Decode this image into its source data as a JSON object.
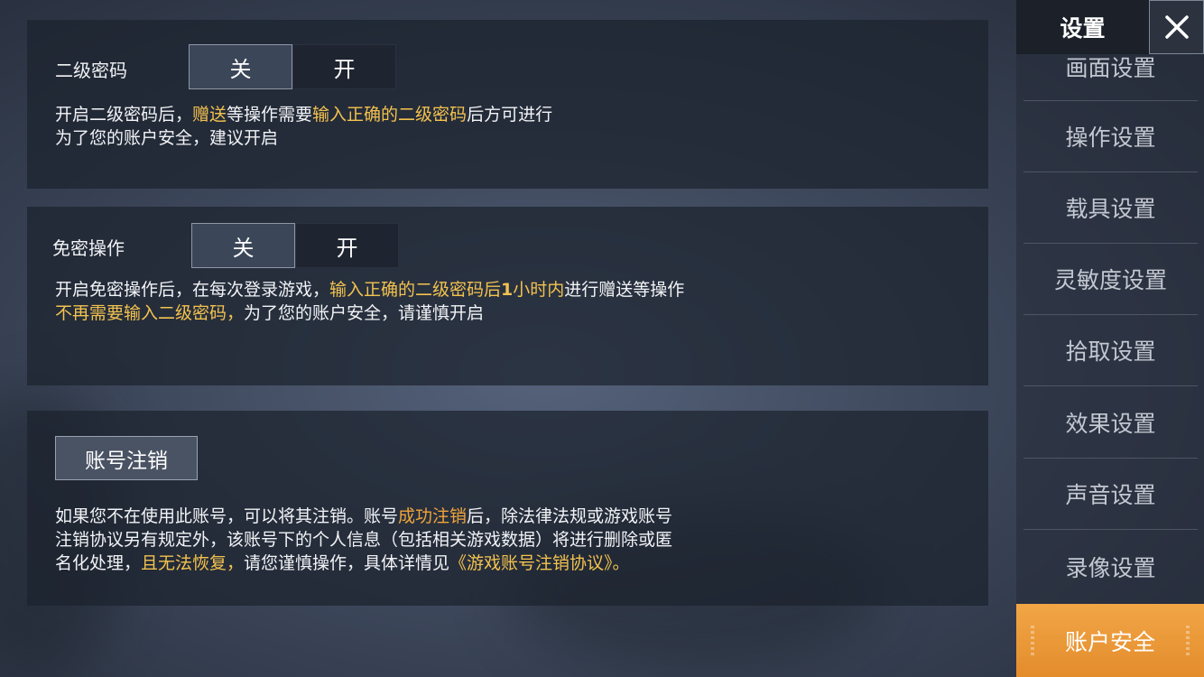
{
  "header": {
    "title": "设置"
  },
  "sidebar": {
    "items": [
      {
        "label": "画面设置"
      },
      {
        "label": "操作设置"
      },
      {
        "label": "载具设置"
      },
      {
        "label": "灵敏度设置"
      },
      {
        "label": "拾取设置"
      },
      {
        "label": "效果设置"
      },
      {
        "label": "声音设置"
      },
      {
        "label": "录像设置"
      },
      {
        "label": "账户安全",
        "active": true
      }
    ]
  },
  "secondary_password": {
    "label": "二级密码",
    "off": "关",
    "on": "开",
    "selected": "关",
    "desc": {
      "line1_a": "开启二级密码后，",
      "line1_b": "赠送",
      "line1_c": "等操作需要",
      "line1_d": "输入正确的二级密码",
      "line1_e": "后方可进行",
      "line2": "为了您的账户安全，建议开启"
    }
  },
  "password_free": {
    "label": "免密操作",
    "off": "关",
    "on": "开",
    "selected": "关",
    "desc": {
      "line1_a": "开启免密操作后，在每次登录游戏，",
      "line1_b": "输入正确的二级密码后",
      "line1_c": "1",
      "line1_d": "小时内",
      "line1_e": "进行赠送等操作",
      "line2_a": "不再需要输入二级密码，",
      "line2_b": "为了您的账户安全，请谨慎开启"
    }
  },
  "account_cancel": {
    "button": "账号注销",
    "desc": {
      "line1_a": "如果您不在使用此账号，可以将其注销。账号",
      "line1_b": "成功注销",
      "line1_c": "后，除法律法规或游戏账号",
      "line2": "注销协议另有规定外，该账号下的个人信息（包括相关游戏数据）将进行删除或匿",
      "line3_a": "名化处理，",
      "line3_b": "且无法恢复，",
      "line3_c": "请您谨慎操作，具体详情见",
      "line3_d": "《游戏账号注销协议》。"
    }
  },
  "colors": {
    "highlight": "#f3c24f",
    "highlight_orange": "#f0a43a",
    "active_tab": "#e9982f"
  },
  "icons": {
    "close": "close-icon"
  }
}
